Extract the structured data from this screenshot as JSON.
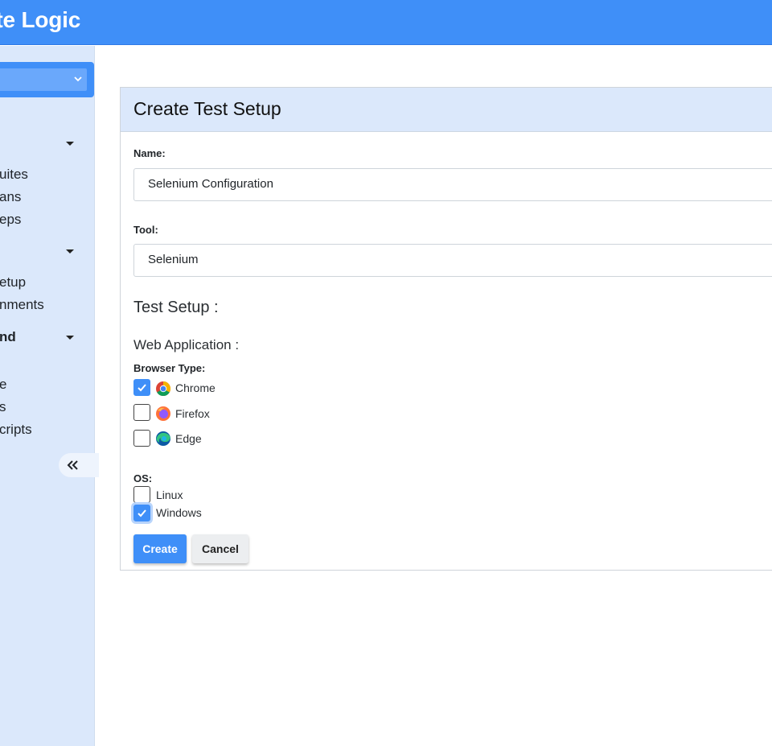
{
  "app": {
    "title": "ate Logic"
  },
  "sidebar": {
    "items": [
      {
        "label": "uites",
        "bold": false
      },
      {
        "label": "ans",
        "bold": false
      },
      {
        "label": "eps",
        "bold": false
      },
      {
        "label": "etup",
        "bold": false
      },
      {
        "label": "nments",
        "bold": false
      },
      {
        "label": "nd",
        "bold": true
      },
      {
        "label": "e",
        "bold": false
      },
      {
        "label": "s",
        "bold": false
      },
      {
        "label": "cripts",
        "bold": false
      }
    ]
  },
  "panel": {
    "title": "Create Test Setup"
  },
  "form": {
    "name_label": "Name:",
    "name_value": "Selenium Configuration",
    "tool_label": "Tool:",
    "tool_value": "Selenium",
    "test_setup_heading": "Test Setup :",
    "web_app_heading": "Web Application :",
    "browser_type_label": "Browser Type:",
    "browsers": [
      {
        "label": "Chrome",
        "checked": true,
        "icon": "chrome-icon"
      },
      {
        "label": "Firefox",
        "checked": false,
        "icon": "firefox-icon"
      },
      {
        "label": "Edge",
        "checked": false,
        "icon": "edge-icon"
      }
    ],
    "os_label": "OS:",
    "os_options": [
      {
        "label": "Linux",
        "checked": false
      },
      {
        "label": "Windows",
        "checked": true
      }
    ],
    "create_label": "Create",
    "cancel_label": "Cancel"
  },
  "colors": {
    "primary": "#3f8ff8",
    "sidebar_bg": "#dbe8fb",
    "panel_header_bg": "#dbe8fb"
  }
}
